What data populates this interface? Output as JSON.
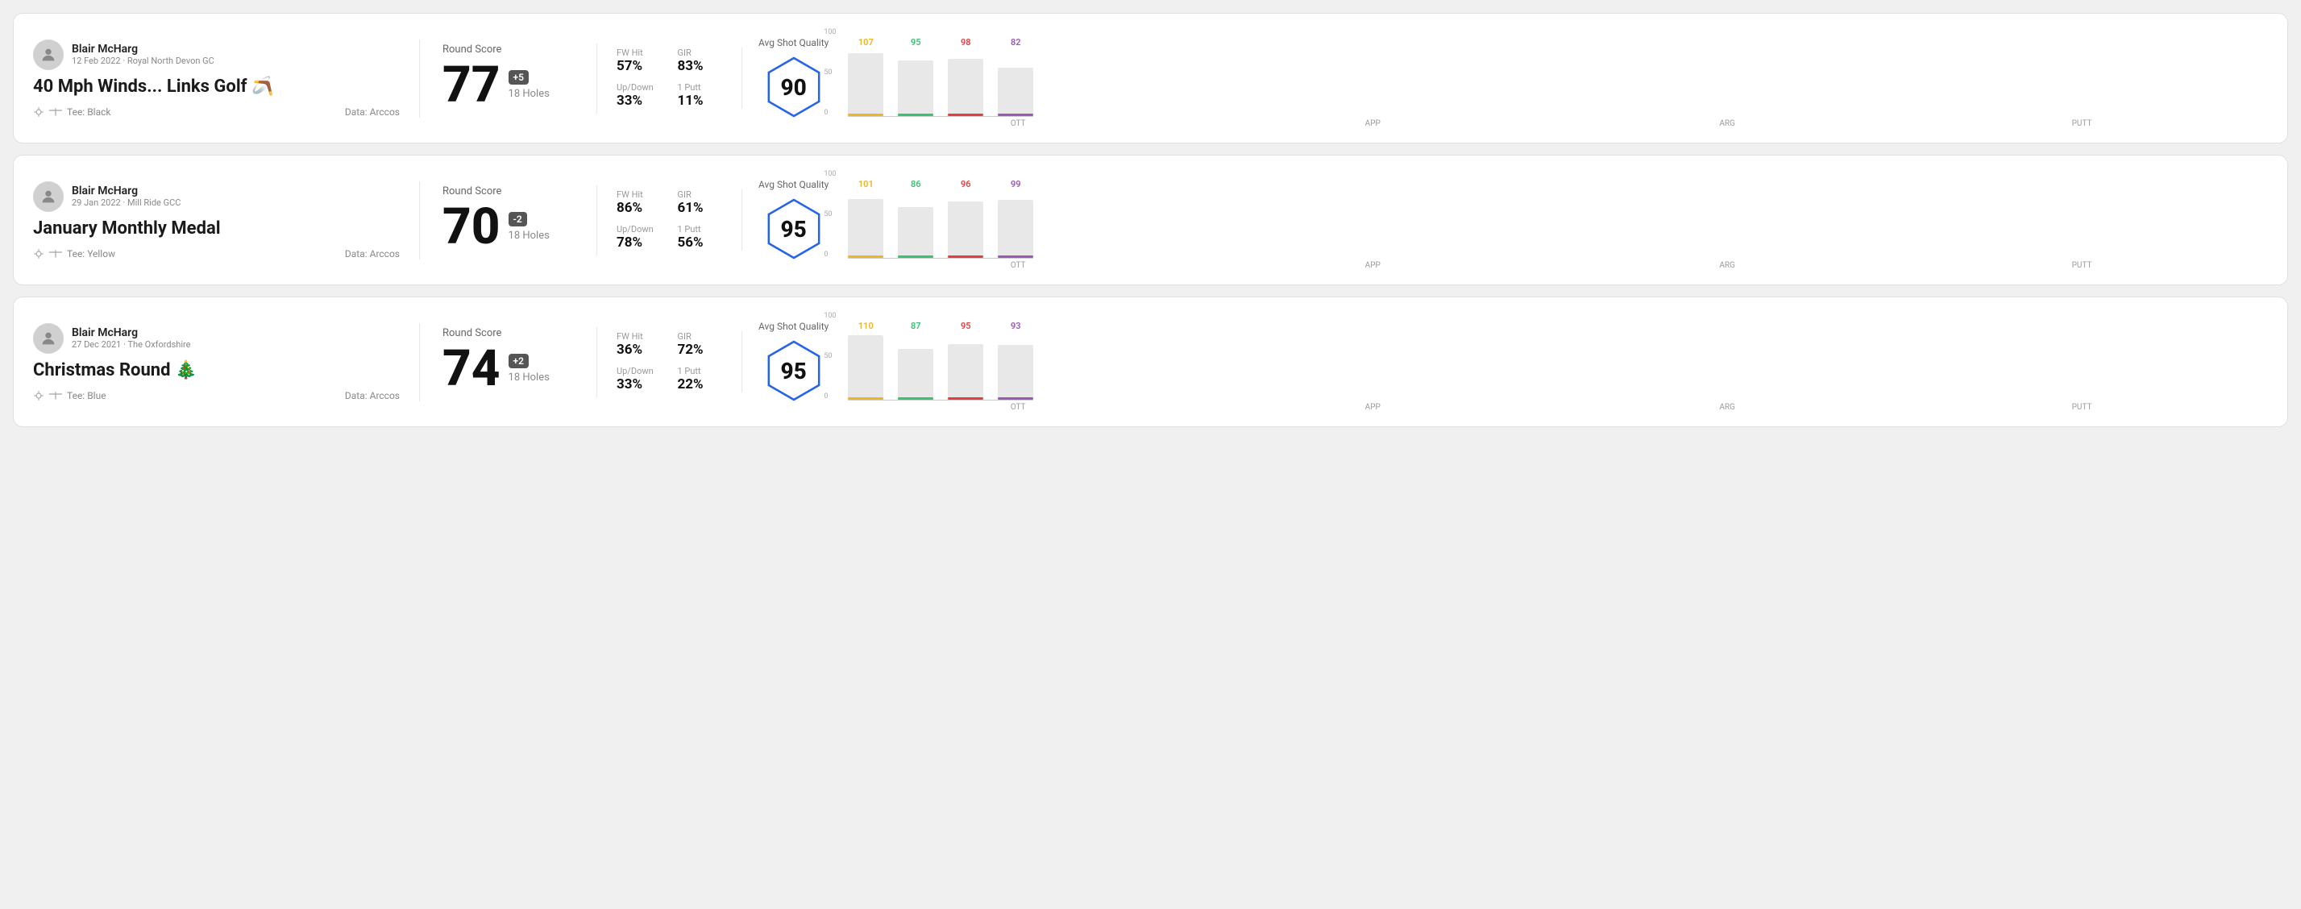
{
  "rounds": [
    {
      "id": "round-1",
      "user": {
        "name": "Blair McHarg",
        "date": "12 Feb 2022",
        "course": "Royal North Devon GC"
      },
      "title": "40 Mph Winds... Links Golf 🪃",
      "tee": "Black",
      "data_source": "Arccos",
      "round_score_label": "Round Score",
      "score": "77",
      "score_diff": "+5",
      "holes": "18 Holes",
      "fw_hit_label": "FW Hit",
      "fw_hit_value": "57%",
      "gir_label": "GIR",
      "gir_value": "83%",
      "up_down_label": "Up/Down",
      "up_down_value": "33%",
      "one_putt_label": "1 Putt",
      "one_putt_value": "11%",
      "avg_shot_quality_label": "Avg Shot Quality",
      "avg_shot_quality_score": "90",
      "bars": [
        {
          "label": "OTT",
          "value": 107,
          "color": "#f0b429",
          "height_pct": 75
        },
        {
          "label": "APP",
          "value": 95,
          "color": "#38c172",
          "height_pct": 62
        },
        {
          "label": "ARG",
          "value": 98,
          "color": "#e53e3e",
          "height_pct": 65
        },
        {
          "label": "PUTT",
          "value": 82,
          "color": "#9b59b6",
          "height_pct": 52
        }
      ]
    },
    {
      "id": "round-2",
      "user": {
        "name": "Blair McHarg",
        "date": "29 Jan 2022",
        "course": "Mill Ride GCC"
      },
      "title": "January Monthly Medal",
      "tee": "Yellow",
      "data_source": "Arccos",
      "round_score_label": "Round Score",
      "score": "70",
      "score_diff": "-2",
      "holes": "18 Holes",
      "fw_hit_label": "FW Hit",
      "fw_hit_value": "86%",
      "gir_label": "GIR",
      "gir_value": "61%",
      "up_down_label": "Up/Down",
      "up_down_value": "78%",
      "one_putt_label": "1 Putt",
      "one_putt_value": "56%",
      "avg_shot_quality_label": "Avg Shot Quality",
      "avg_shot_quality_score": "95",
      "bars": [
        {
          "label": "OTT",
          "value": 101,
          "color": "#f0b429",
          "height_pct": 72
        },
        {
          "label": "APP",
          "value": 86,
          "color": "#38c172",
          "height_pct": 56
        },
        {
          "label": "ARG",
          "value": 96,
          "color": "#e53e3e",
          "height_pct": 64
        },
        {
          "label": "PUTT",
          "value": 99,
          "color": "#9b59b6",
          "height_pct": 66
        }
      ]
    },
    {
      "id": "round-3",
      "user": {
        "name": "Blair McHarg",
        "date": "27 Dec 2021",
        "course": "The Oxfordshire"
      },
      "title": "Christmas Round 🎄",
      "tee": "Blue",
      "data_source": "Arccos",
      "round_score_label": "Round Score",
      "score": "74",
      "score_diff": "+2",
      "holes": "18 Holes",
      "fw_hit_label": "FW Hit",
      "fw_hit_value": "36%",
      "gir_label": "GIR",
      "gir_value": "72%",
      "up_down_label": "Up/Down",
      "up_down_value": "33%",
      "one_putt_label": "1 Putt",
      "one_putt_value": "22%",
      "avg_shot_quality_label": "Avg Shot Quality",
      "avg_shot_quality_score": "95",
      "bars": [
        {
          "label": "OTT",
          "value": 110,
          "color": "#f0b429",
          "height_pct": 78
        },
        {
          "label": "APP",
          "value": 87,
          "color": "#38c172",
          "height_pct": 57
        },
        {
          "label": "ARG",
          "value": 95,
          "color": "#e53e3e",
          "height_pct": 63
        },
        {
          "label": "PUTT",
          "value": 93,
          "color": "#9b59b6",
          "height_pct": 62
        }
      ]
    }
  ],
  "y_axis_labels": [
    "100",
    "50",
    "0"
  ]
}
